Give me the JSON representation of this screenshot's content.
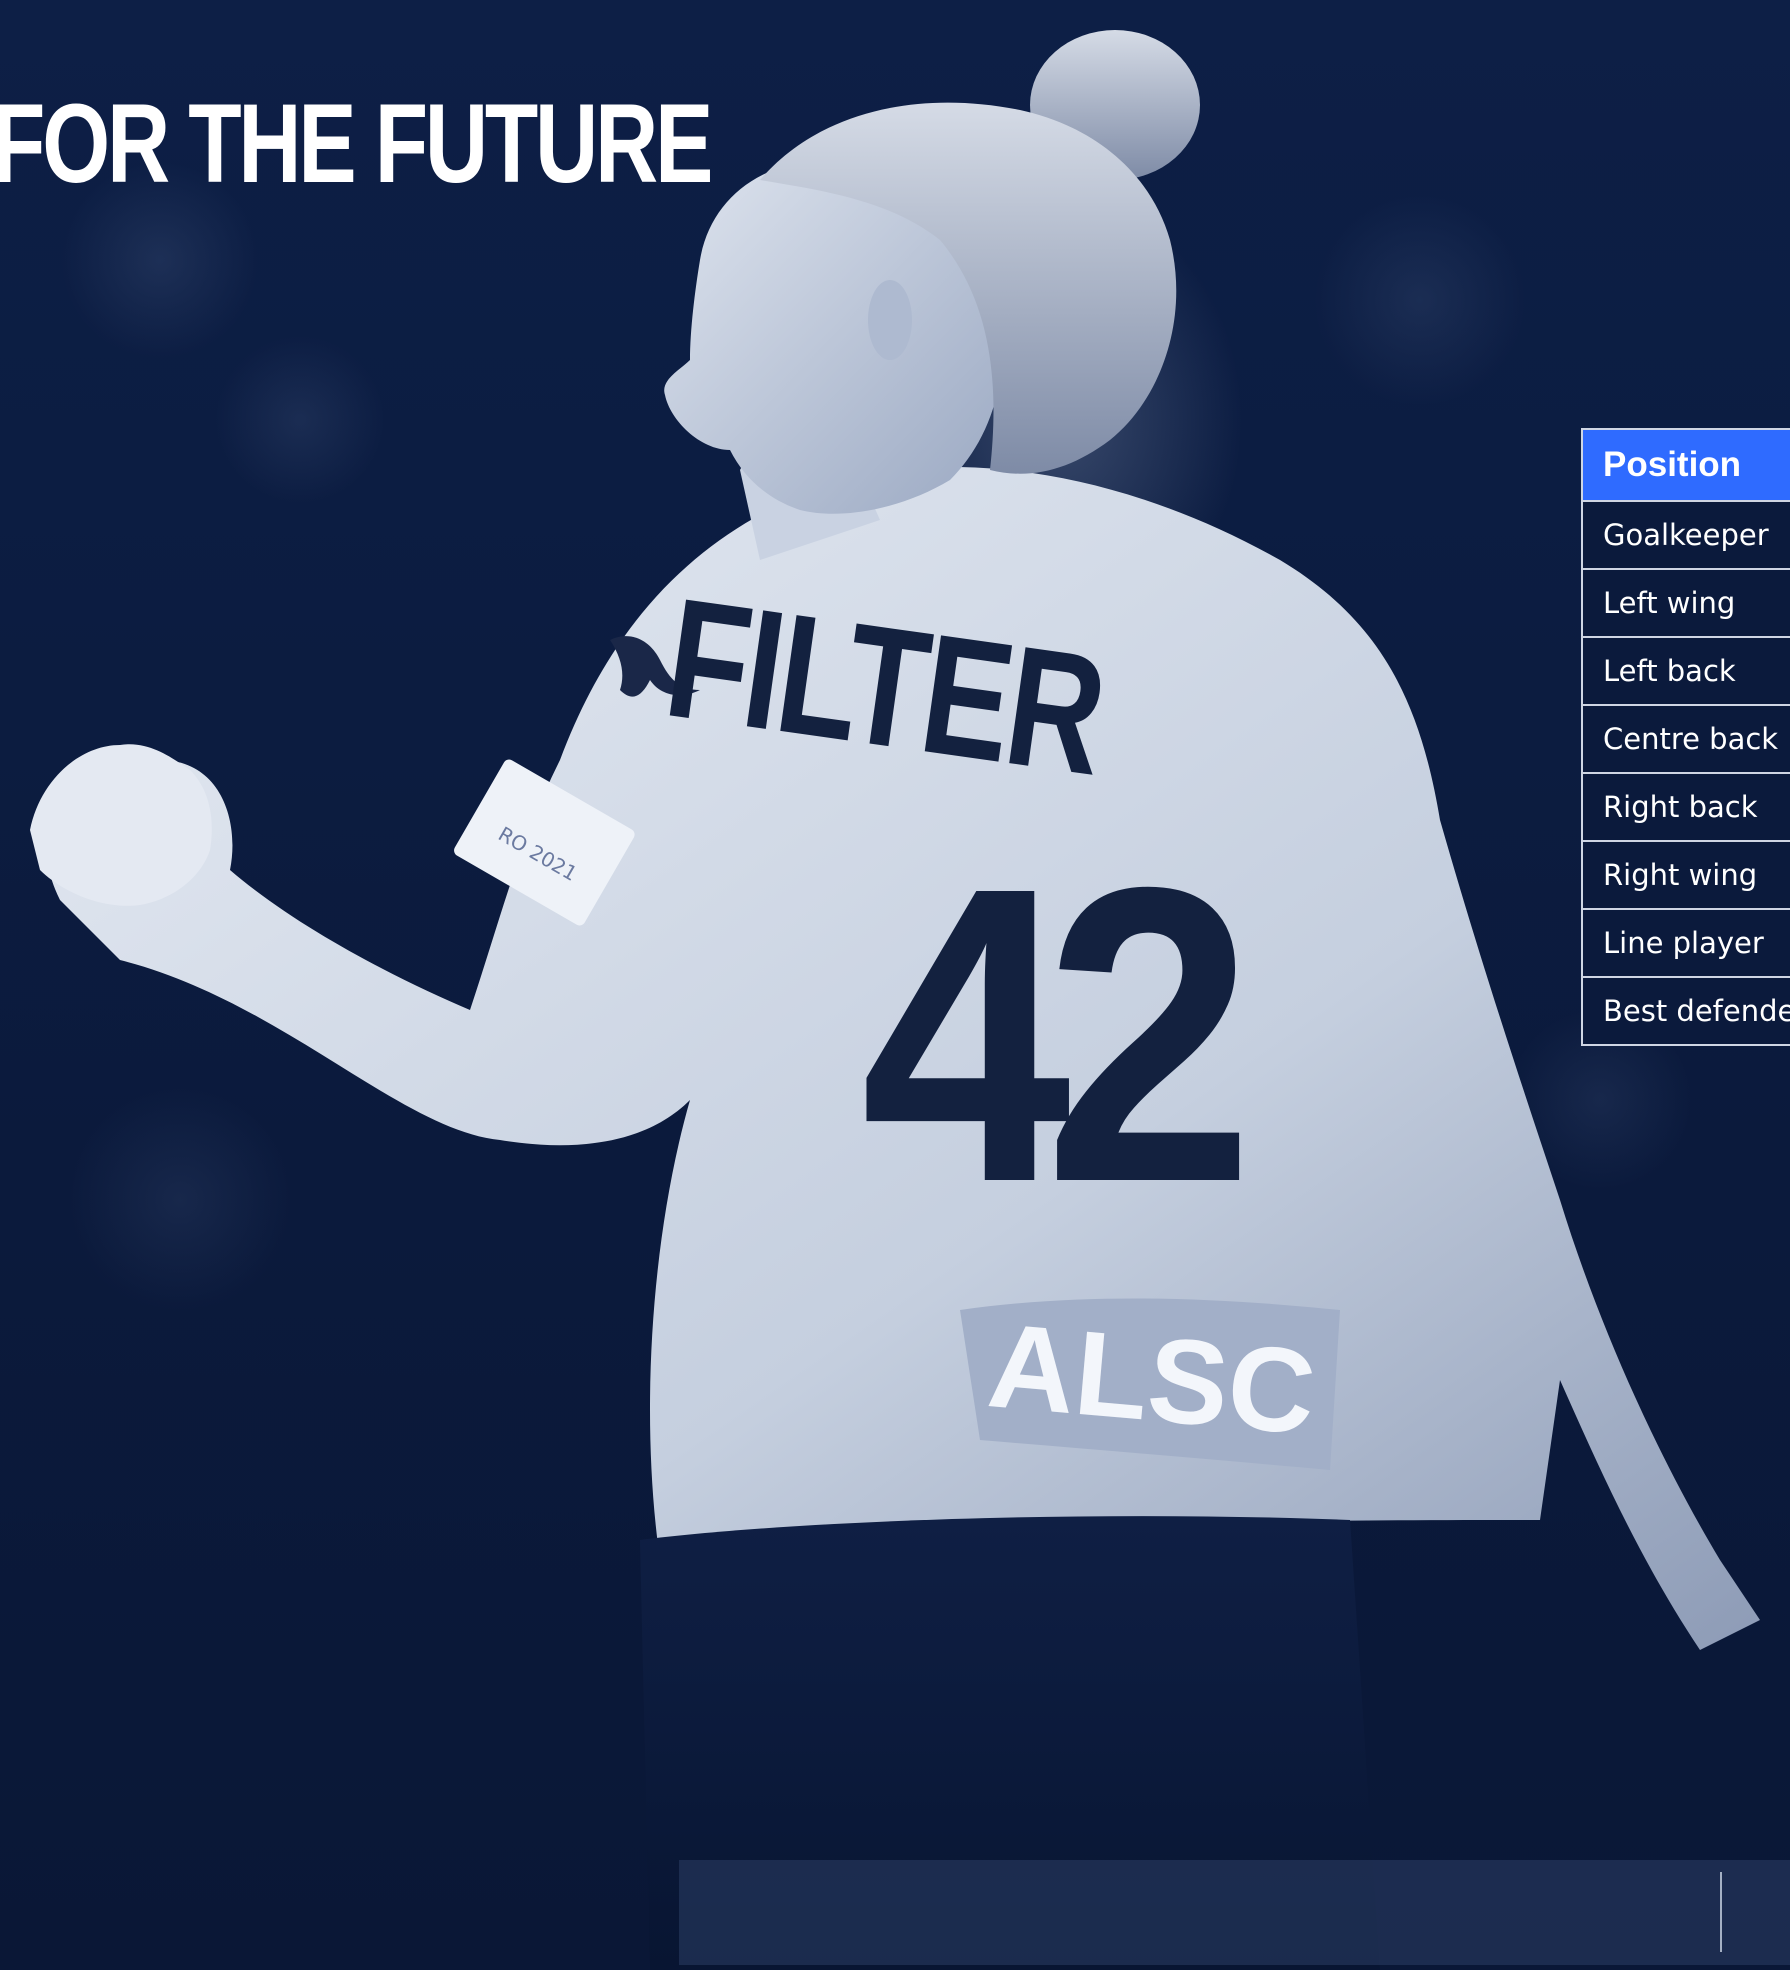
{
  "headline": "FOR THE FUTURE",
  "photo": {
    "jersey_name": "FILTER",
    "jersey_number": "42",
    "sponsor": "ALSC"
  },
  "positions": {
    "header": "Position",
    "items": [
      "Goalkeeper",
      "Left wing",
      "Left back",
      "Centre back",
      "Right back",
      "Right wing",
      "Line player",
      "Best defender"
    ]
  },
  "colors": {
    "background": "#0b1a3c",
    "accent": "#2f6bff",
    "text": "#ffffff"
  }
}
